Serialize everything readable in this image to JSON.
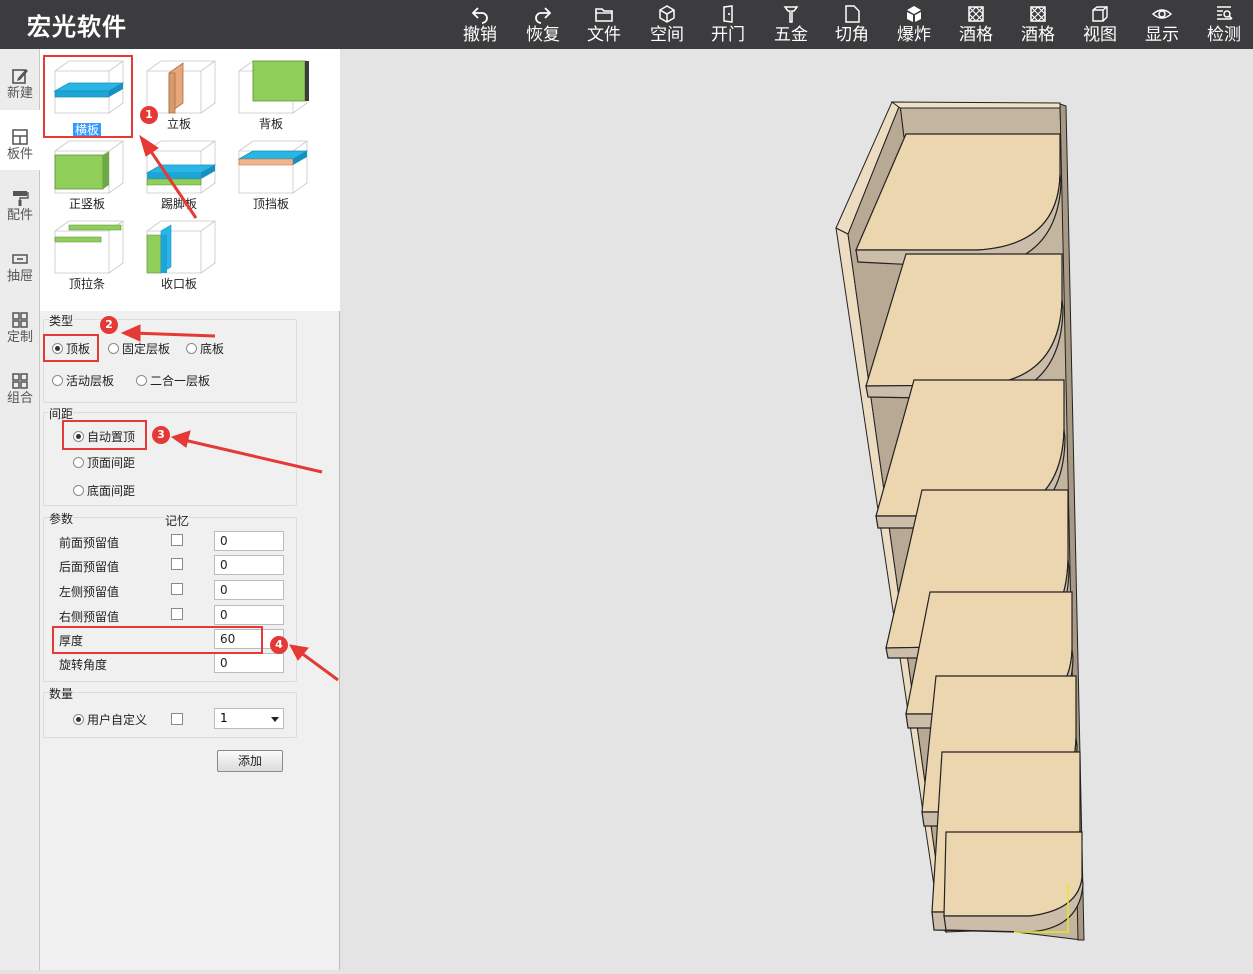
{
  "app": {
    "title": "宏光软件"
  },
  "toolbar": [
    {
      "label": "撤销",
      "icon": "undo-icon"
    },
    {
      "label": "恢复",
      "icon": "redo-icon"
    },
    {
      "label": "文件",
      "icon": "folder-icon"
    },
    {
      "label": "空间",
      "icon": "cube-icon"
    },
    {
      "label": "开门",
      "icon": "door-icon"
    },
    {
      "label": "五金",
      "icon": "hardware-icon"
    },
    {
      "label": "切角",
      "icon": "cut-corner-icon"
    },
    {
      "label": "爆炸",
      "icon": "explode-icon"
    },
    {
      "label": "酒格",
      "icon": "wine-rack-icon"
    },
    {
      "label": "酒格",
      "icon": "wine-rack-icon"
    },
    {
      "label": "视图",
      "icon": "view-icon"
    },
    {
      "label": "显示",
      "icon": "eye-icon"
    },
    {
      "label": "检测",
      "icon": "inspect-icon"
    }
  ],
  "leftnav": [
    {
      "label": "新建",
      "icon": "edit-icon"
    },
    {
      "label": "板件",
      "icon": "board-icon"
    },
    {
      "label": "配件",
      "icon": "roller-icon"
    },
    {
      "label": "抽屉",
      "icon": "drawer-icon"
    },
    {
      "label": "定制",
      "icon": "grid-icon"
    },
    {
      "label": "组合",
      "icon": "grid-icon"
    }
  ],
  "gallery": [
    {
      "label": "横板",
      "selected": true
    },
    {
      "label": "立板"
    },
    {
      "label": "背板"
    },
    {
      "label": "正竖板"
    },
    {
      "label": "踢脚板"
    },
    {
      "label": "顶挡板"
    },
    {
      "label": "顶拉条"
    },
    {
      "label": "收口板"
    }
  ],
  "type_group": {
    "title": "类型",
    "options": [
      "顶板",
      "固定层板",
      "底板",
      "活动层板",
      "二合一层板"
    ],
    "selected": "顶板"
  },
  "spacing_group": {
    "title": "间距",
    "options": [
      "自动置顶",
      "顶面间距",
      "底面间距"
    ],
    "selected": "自动置顶"
  },
  "params_group": {
    "title": "参数",
    "memory_label": "记忆",
    "rows": [
      {
        "label": "前面预留值",
        "value": "0"
      },
      {
        "label": "后面预留值",
        "value": "0"
      },
      {
        "label": "左侧预留值",
        "value": "0"
      },
      {
        "label": "右侧预留值",
        "value": "0"
      },
      {
        "label": "厚度",
        "value": "60"
      },
      {
        "label": "旋转角度",
        "value": "0"
      }
    ]
  },
  "quantity_group": {
    "title": "数量",
    "option": "用户自定义",
    "value": "1"
  },
  "add_button": "添加",
  "annotations": [
    "1",
    "2",
    "3",
    "4"
  ],
  "colors": {
    "topbar": "#3c3c3e",
    "highlight": "#e53935",
    "selection": "#3399ff",
    "wood": "#ead1a8",
    "carcass": "#b8a994"
  }
}
